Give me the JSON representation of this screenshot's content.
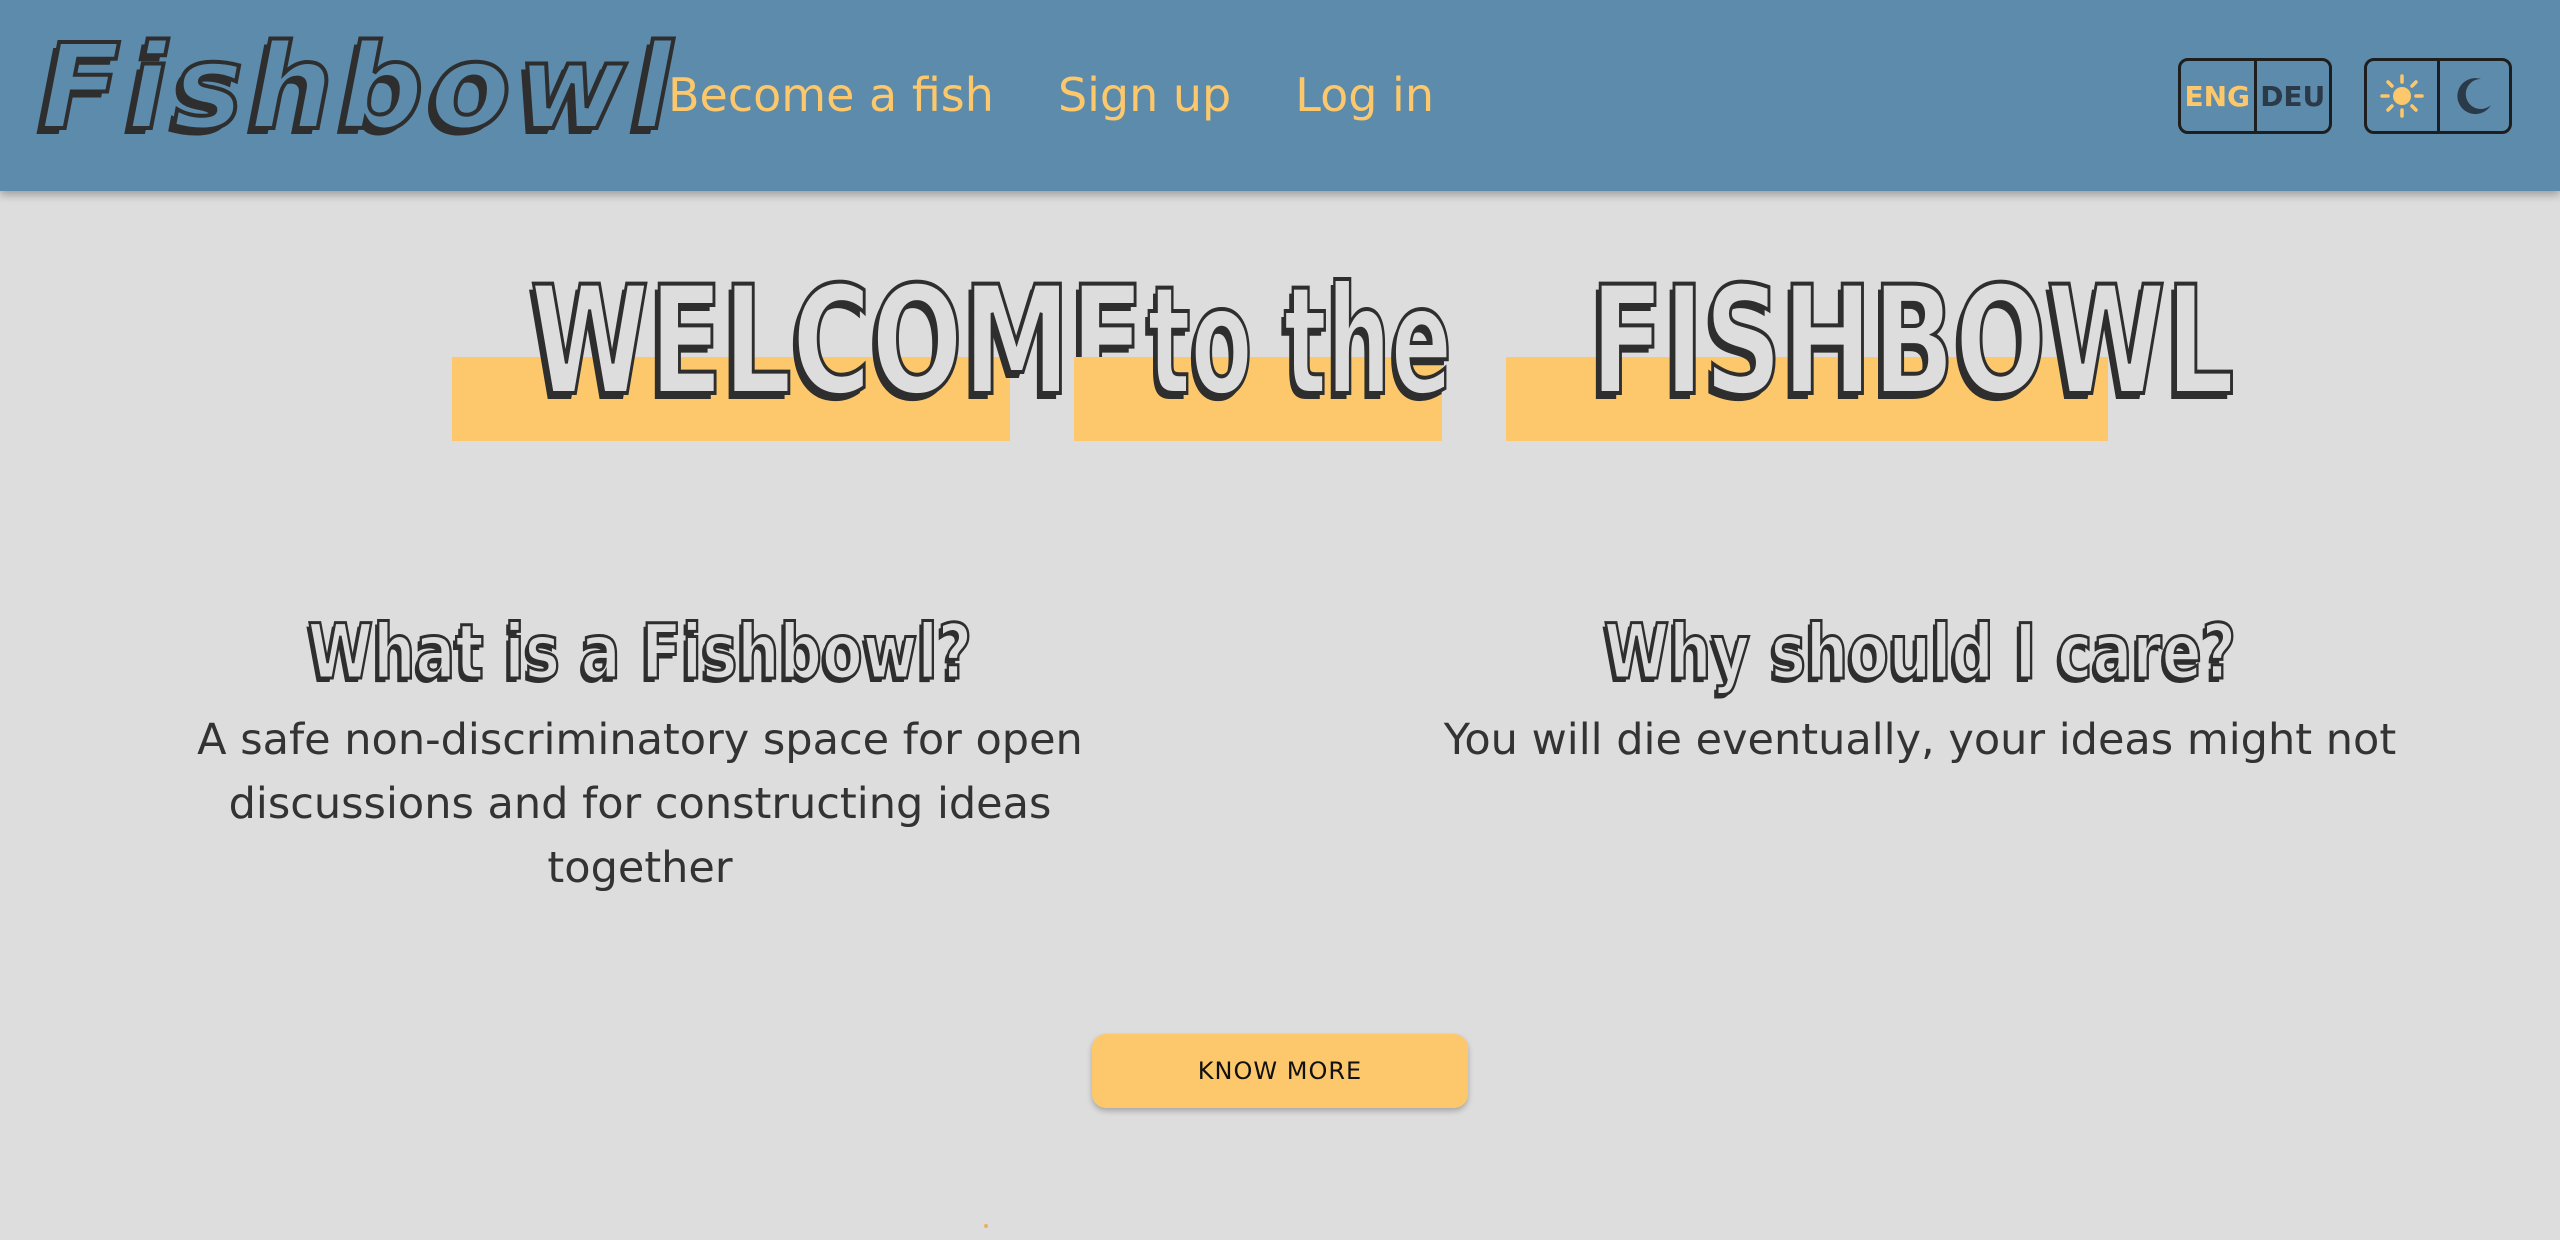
{
  "header": {
    "logo": "Fishbowl",
    "nav": [
      {
        "label": "Become a fish"
      },
      {
        "label": "Sign up"
      },
      {
        "label": "Log in"
      }
    ],
    "language": {
      "options": [
        "ENG",
        "DEU"
      ],
      "active": "ENG"
    },
    "theme": {
      "options": [
        "sun-icon",
        "moon-icon"
      ],
      "active": "light"
    }
  },
  "hero": {
    "words": [
      "WELCOME",
      "to the",
      "FISHBOWL"
    ]
  },
  "sections": [
    {
      "title": "What is a Fishbowl?",
      "text": "A safe non-discriminatory space for open discussions and for constructing ideas together"
    },
    {
      "title": "Why should I care?",
      "text": "You will die eventually, your ideas might not"
    }
  ],
  "cta": {
    "label": "KNOW MORE"
  },
  "colors": {
    "header_bg": "#5d8bab",
    "accent": "#fcc86b",
    "page_bg": "#dddddd",
    "ink": "#2e2e2e"
  }
}
